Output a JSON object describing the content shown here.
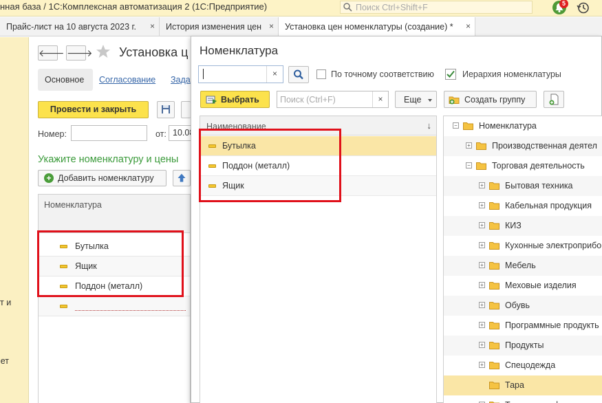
{
  "app": {
    "title": "нная база / 1С:Комплексная автоматизация 2  (1С:Предприятие)",
    "search_placeholder": "Поиск Ctrl+Shift+F",
    "notifications_count": "5"
  },
  "tabs": [
    {
      "label": "Прайс-лист на 10 августа 2023 г."
    },
    {
      "label": "История изменения цен"
    },
    {
      "label": "Установка цен номенклатуры (создание) *"
    }
  ],
  "sidebar": {
    "text1": "т и",
    "text2": "учет"
  },
  "form": {
    "title": "Установка ц",
    "tab_main": "Основное",
    "tab_approval": "Согласование",
    "tab_tasks": "Зада",
    "post_close": "Провести и закрыть",
    "number_label": "Номер:",
    "date_label": "от:",
    "date_value": "10.08",
    "section_heading": "Укажите номенклатуру и цены",
    "add_nomenclature": "Добавить номенклатуру",
    "grid_header": "Номенклатура",
    "rows": [
      "Бутылка",
      "Ящик",
      "Поддон (металл)"
    ]
  },
  "dialog": {
    "title": "Номенклатура",
    "exact_match": "По точному соответствию",
    "hierarchy": "Иерархия номенклатуры",
    "select_button": "Выбрать",
    "filter_placeholder": "Поиск (Ctrl+F)",
    "more_button": "Еще",
    "create_group": "Создать группу",
    "list_header": "Наименование",
    "list_items": [
      "Бутылка",
      "Поддон (металл)",
      "Ящик"
    ],
    "tree": [
      {
        "label": "Номенклатура",
        "level": 0,
        "sign": "-"
      },
      {
        "label": "Производственная деятел",
        "level": 1,
        "sign": "+"
      },
      {
        "label": "Торговая деятельность",
        "level": 1,
        "sign": "-"
      },
      {
        "label": "Бытовая техника",
        "level": 2,
        "sign": "+"
      },
      {
        "label": "Кабельная продукция",
        "level": 2,
        "sign": "+"
      },
      {
        "label": "КИЗ",
        "level": 2,
        "sign": "+"
      },
      {
        "label": "Кухонные электроприбо",
        "level": 2,
        "sign": "+"
      },
      {
        "label": "Мебель",
        "level": 2,
        "sign": "+"
      },
      {
        "label": "Меховые изделия",
        "level": 2,
        "sign": "+"
      },
      {
        "label": "Обувь",
        "level": 2,
        "sign": "+"
      },
      {
        "label": "Программные продукть",
        "level": 2,
        "sign": "+"
      },
      {
        "label": "Продукты",
        "level": 2,
        "sign": "+"
      },
      {
        "label": "Спецодежда",
        "level": 2,
        "sign": "+"
      },
      {
        "label": "Тара",
        "level": 2,
        "sign": ""
      },
      {
        "label": "Товары с дефектами",
        "level": 2,
        "sign": "+"
      }
    ]
  },
  "colors": {
    "accent_yellow": "#fce24c",
    "highlight": "#fae6a6",
    "annotation_red": "#e0101a",
    "link": "#3666a8",
    "heading_green": "#3a9a3a"
  }
}
